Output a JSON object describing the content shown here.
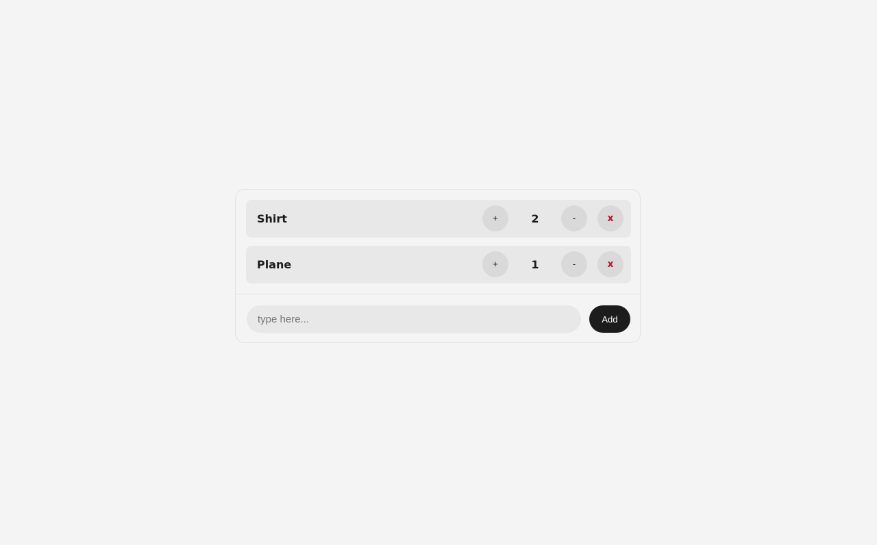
{
  "cart": {
    "items": [
      {
        "name": "Shirt",
        "quantity": "2"
      },
      {
        "name": "Plane",
        "quantity": "1"
      }
    ],
    "controls": {
      "increment_label": "+",
      "decrement_label": "-",
      "remove_label": "x"
    }
  },
  "form": {
    "input_value": "",
    "input_placeholder": "type here...",
    "add_label": "Add"
  },
  "colors": {
    "background": "#f4f4f4",
    "row_background": "#e8e8e8",
    "button_background": "#d9d9d9",
    "remove_accent": "#c8102e",
    "add_button": "#1c1c1c"
  }
}
